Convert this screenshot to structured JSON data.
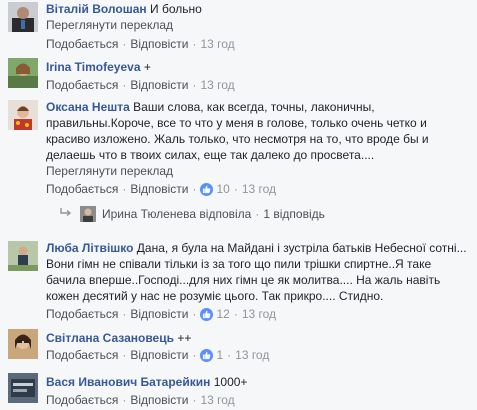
{
  "comments": [
    {
      "author": "Віталій Волошан",
      "text": "И больно",
      "translate": "Переглянути переклад",
      "like": "Подобається",
      "reply": "Відповісти",
      "time": "13 год"
    },
    {
      "author": "Irina Timofeyeva",
      "text": "+",
      "like": "Подобається",
      "reply": "Відповісти",
      "time": "13 год"
    },
    {
      "author": "Оксана Нешта",
      "text": "Ваши слова, как всегда, точны, лаконичны, правильны.Короче, все то что у меня в голове, только очень четко и красиво изложено. Жаль только, что несмотря на то, что вроде бы и делаешь что в твоих силах, еще так далеко до просвета....",
      "translate": "Переглянути переклад",
      "like": "Подобається",
      "reply": "Відповісти",
      "likes": "10",
      "time": "13 год"
    },
    {
      "author": "Люба Літвішко",
      "text": "Дана, я була на Майдані і зустріла батьків Небесної сотні... Вони гімн не співали тільки із за того що пили трішки спиртне..Я таке бачила вперше..Господі...для них гімн це як молитва.... На жаль навіть кожен десятий у нас не розуміє цього. Так прикро.... Стидно.",
      "like": "Подобається",
      "reply": "Відповісти",
      "likes": "12",
      "time": "13 год"
    },
    {
      "author": "Світлана Сазановець",
      "text": "++",
      "like": "Подобається",
      "reply": "Відповісти",
      "likes": "1",
      "time": "13 год"
    },
    {
      "author": "Вася Иванович Батарейкин",
      "text": "1000+",
      "like": "Подобається",
      "reply": "Відповісти",
      "time": "13 год"
    }
  ],
  "reply_thread": {
    "text": "Ирина Тюленева відповіла",
    "count": "1 відповідь"
  },
  "colors": {
    "author": "#365899",
    "link": "#4b4f56",
    "meta": "#90949c",
    "like_badge": "#5890ff"
  }
}
